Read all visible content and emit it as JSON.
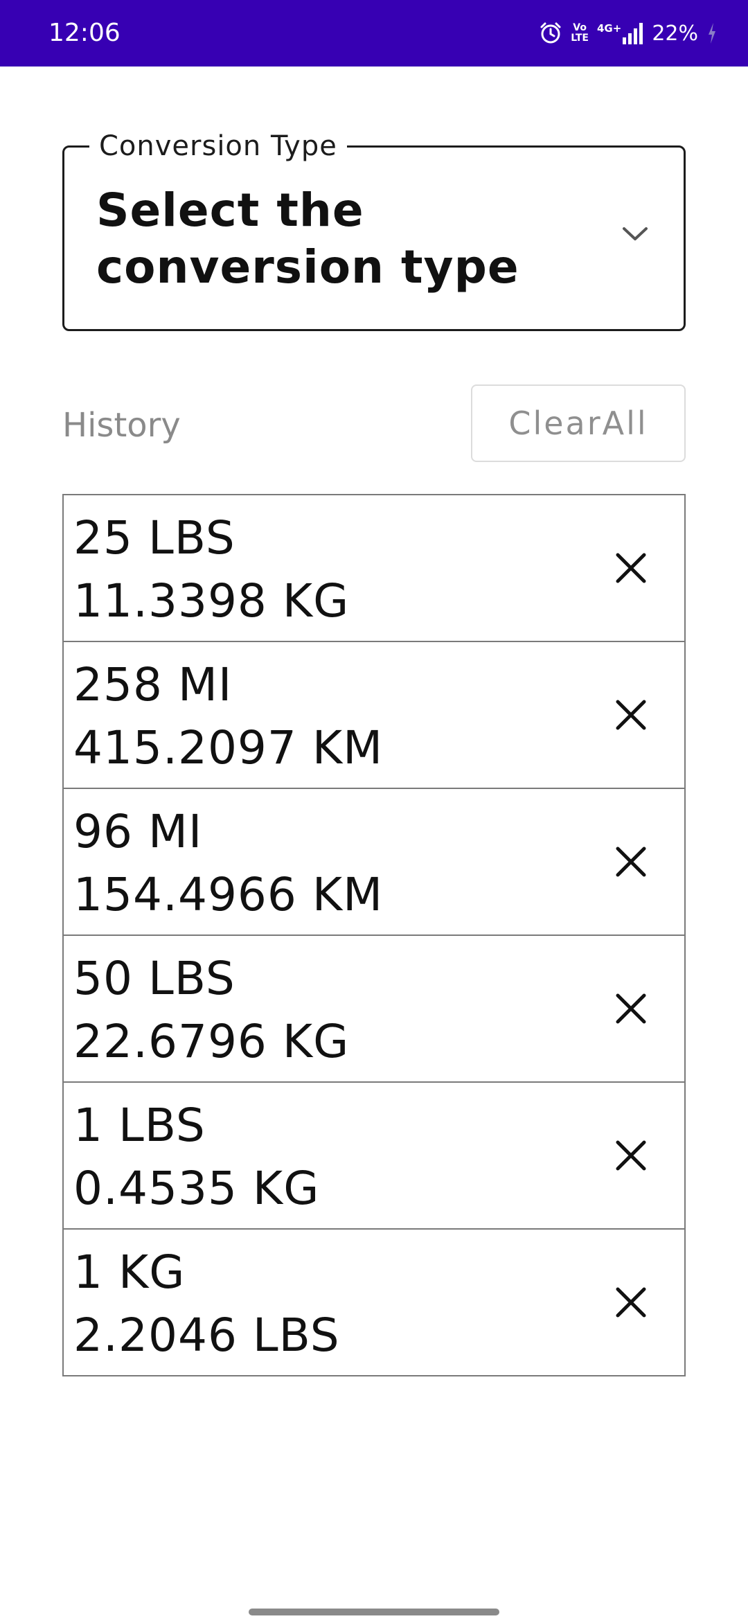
{
  "status_bar": {
    "time": "12:06",
    "battery_percent": "22%",
    "network_label": "4G+",
    "volte_top": "Vo",
    "volte_bottom": "LTE"
  },
  "dropdown": {
    "label": "Conversion Type",
    "value": "Select the conversion type"
  },
  "history": {
    "label": "History",
    "clear_label": "ClearAll",
    "items": [
      {
        "input": "25 LBS",
        "output": "11.3398 KG"
      },
      {
        "input": "258 MI",
        "output": "415.2097 KM"
      },
      {
        "input": "96 MI",
        "output": "154.4966 KM"
      },
      {
        "input": "50 LBS",
        "output": "22.6796 KG"
      },
      {
        "input": "1 LBS",
        "output": "0.4535 KG"
      },
      {
        "input": "1 KG",
        "output": "2.2046 LBS"
      }
    ]
  },
  "colors": {
    "status_bar": "#3700b3",
    "text_primary": "#111111",
    "text_secondary": "#8a8a8a"
  }
}
